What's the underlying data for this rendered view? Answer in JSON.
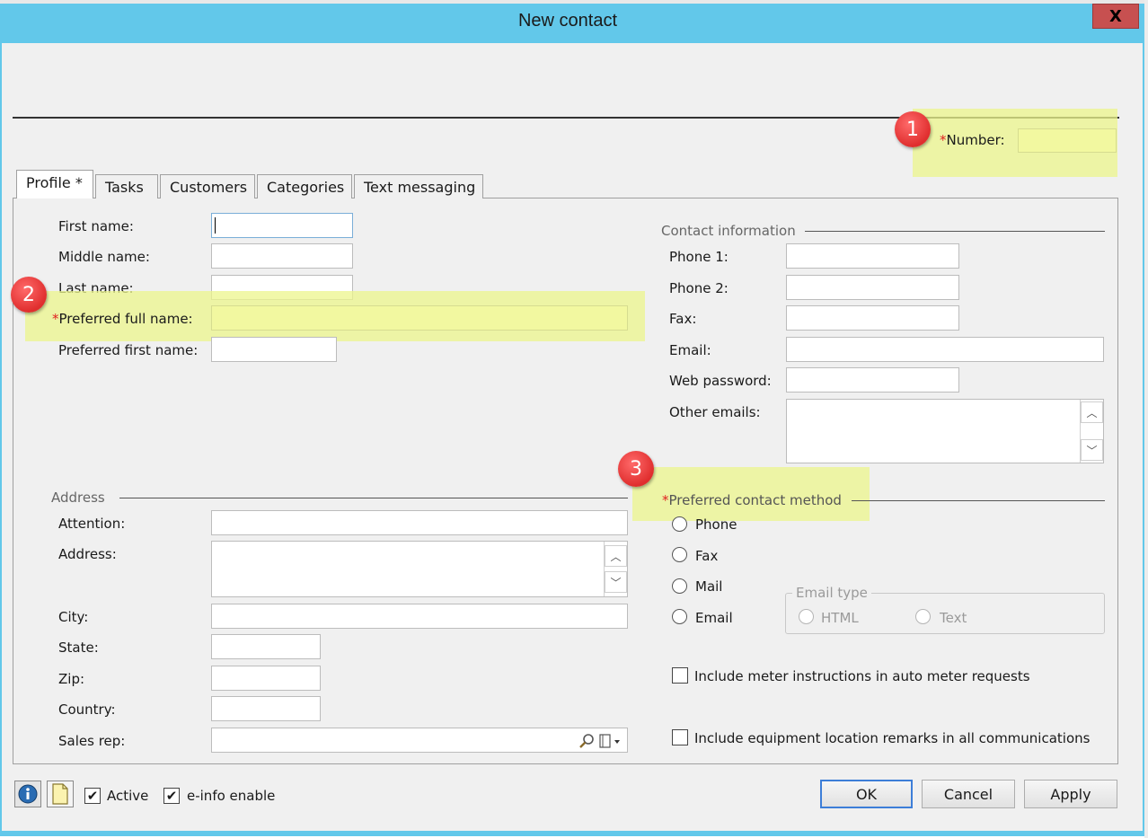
{
  "window": {
    "title": "New contact",
    "close_label": "X"
  },
  "callouts": [
    "1",
    "2",
    "3"
  ],
  "number": {
    "label": "Number:",
    "required": "*",
    "value": ""
  },
  "tabs": [
    {
      "label": "Profile *",
      "active": true
    },
    {
      "label": "Tasks"
    },
    {
      "label": "Customers"
    },
    {
      "label": "Categories"
    },
    {
      "label": "Text messaging"
    }
  ],
  "name": {
    "first_label": "First name:",
    "middle_label": "Middle name:",
    "last_label": "Last name:",
    "preferred_full_label": "Preferred full name:",
    "preferred_full_required": "*",
    "preferred_first_label": "Preferred first name:"
  },
  "contact_info": {
    "title": "Contact information",
    "phone1_label": "Phone 1:",
    "phone2_label": "Phone 2:",
    "fax_label": "Fax:",
    "email_label": "Email:",
    "web_password_label": "Web password:",
    "other_emails_label": "Other emails:"
  },
  "address": {
    "title": "Address",
    "attention_label": "Attention:",
    "address_label": "Address:",
    "city_label": "City:",
    "state_label": "State:",
    "zip_label": "Zip:",
    "country_label": "Country:",
    "sales_rep_label": "Sales rep:"
  },
  "contact_method": {
    "title": "Preferred contact method",
    "required": "*",
    "options": [
      "Phone",
      "Fax",
      "Mail",
      "Email"
    ]
  },
  "email_type": {
    "title": "Email type",
    "options": [
      "HTML",
      "Text"
    ]
  },
  "options": {
    "meter_instructions": "Include meter instructions in auto meter requests",
    "equipment_remarks": "Include equipment location remarks in all communications"
  },
  "footer": {
    "active_label": "Active",
    "active_checked": true,
    "einfo_label": "e-info enable",
    "einfo_checked": true,
    "ok_label": "OK",
    "cancel_label": "Cancel",
    "apply_label": "Apply"
  },
  "colors": {
    "titlebar": "#62c8ea",
    "highlight": "#ecf58c",
    "badge": "#e02e2e",
    "required": "#e02020"
  },
  "icons": [
    "close-icon",
    "info-icon",
    "notes-icon",
    "search-icon",
    "card-dropdown-icon",
    "checkmark-icon",
    "chevron-up-icon",
    "chevron-down-icon"
  ]
}
